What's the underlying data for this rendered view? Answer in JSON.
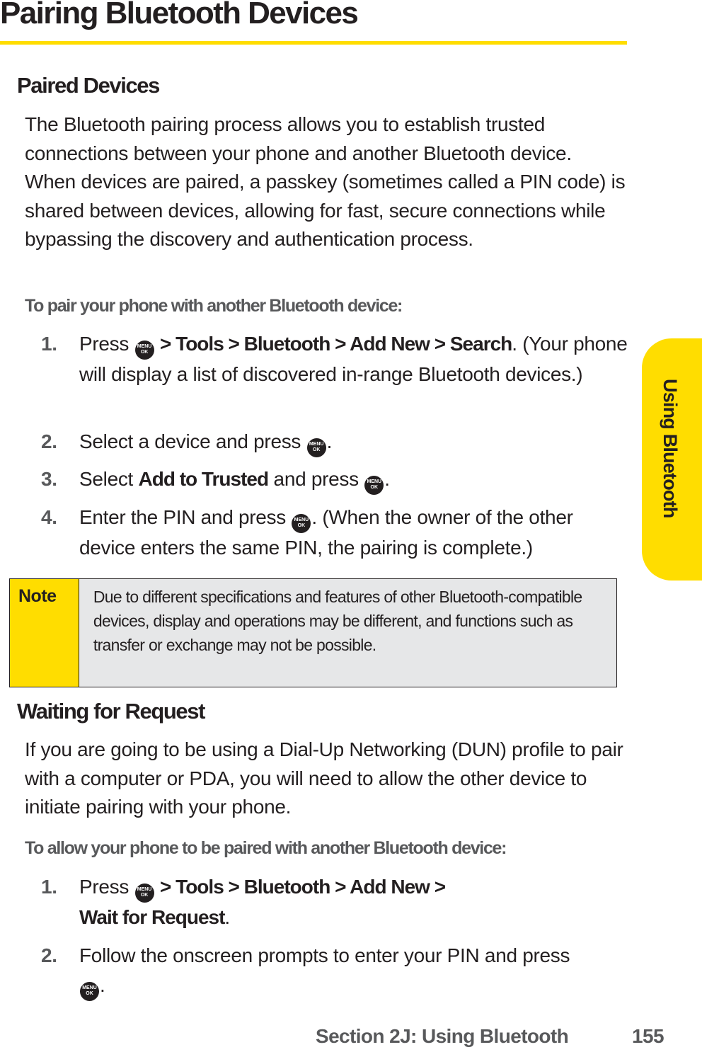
{
  "page": {
    "title": "Pairing Bluetooth Devices",
    "accent_color": "#ffdd00",
    "side_tab": "Using Bluetooth",
    "footer": {
      "section": "Section 2J: Using Bluetooth",
      "page_number": "155"
    }
  },
  "paired_devices": {
    "heading": "Paired Devices",
    "intro": "The Bluetooth pairing process allows you to establish trusted connections between your phone and another Bluetooth device. When devices are paired, a passkey (sometimes called a PIN code) is shared between devices, allowing for fast, secure connections while bypassing the discovery and authentication process.",
    "procedure_title": "To pair your phone with another Bluetooth device:",
    "steps": [
      {
        "num": "1.",
        "pre": "Press",
        "path": "> Tools > Bluetooth > Add New > Search",
        "post": ". (Your phone will display a list of discovered in-range Bluetooth devices.)"
      },
      {
        "num": "2.",
        "pre": "Select a device and press",
        "post": "."
      },
      {
        "num": "3.",
        "pre": "Select",
        "bold": "Add to Trusted",
        "mid": "and press",
        "post": "."
      },
      {
        "num": "4.",
        "pre": "Enter the PIN and press",
        "post": ". (When the owner of the other device enters the same PIN, the pairing is complete.)"
      }
    ]
  },
  "note": {
    "label": "Note",
    "text": "Due to different specifications and features of other Bluetooth-compatible devices, display and operations may be different, and functions such as transfer or exchange may not be possible."
  },
  "waiting": {
    "heading": "Waiting for Request",
    "intro": "If you are going to be using a Dial-Up Networking (DUN) profile to pair with a computer or PDA, you will need to allow the other device to initiate pairing with your phone.",
    "procedure_title": "To allow your phone to be paired with another Bluetooth device:",
    "steps": [
      {
        "num": "1.",
        "pre": "Press",
        "path": "> Tools > Bluetooth > Add New >",
        "path2": "Wait for Request",
        "post": "."
      },
      {
        "num": "2.",
        "pre": "Follow the onscreen prompts to enter your PIN and press",
        "post": "."
      }
    ]
  },
  "icons": {
    "menu_key_top": "MENU",
    "menu_key_bottom": "OK"
  }
}
